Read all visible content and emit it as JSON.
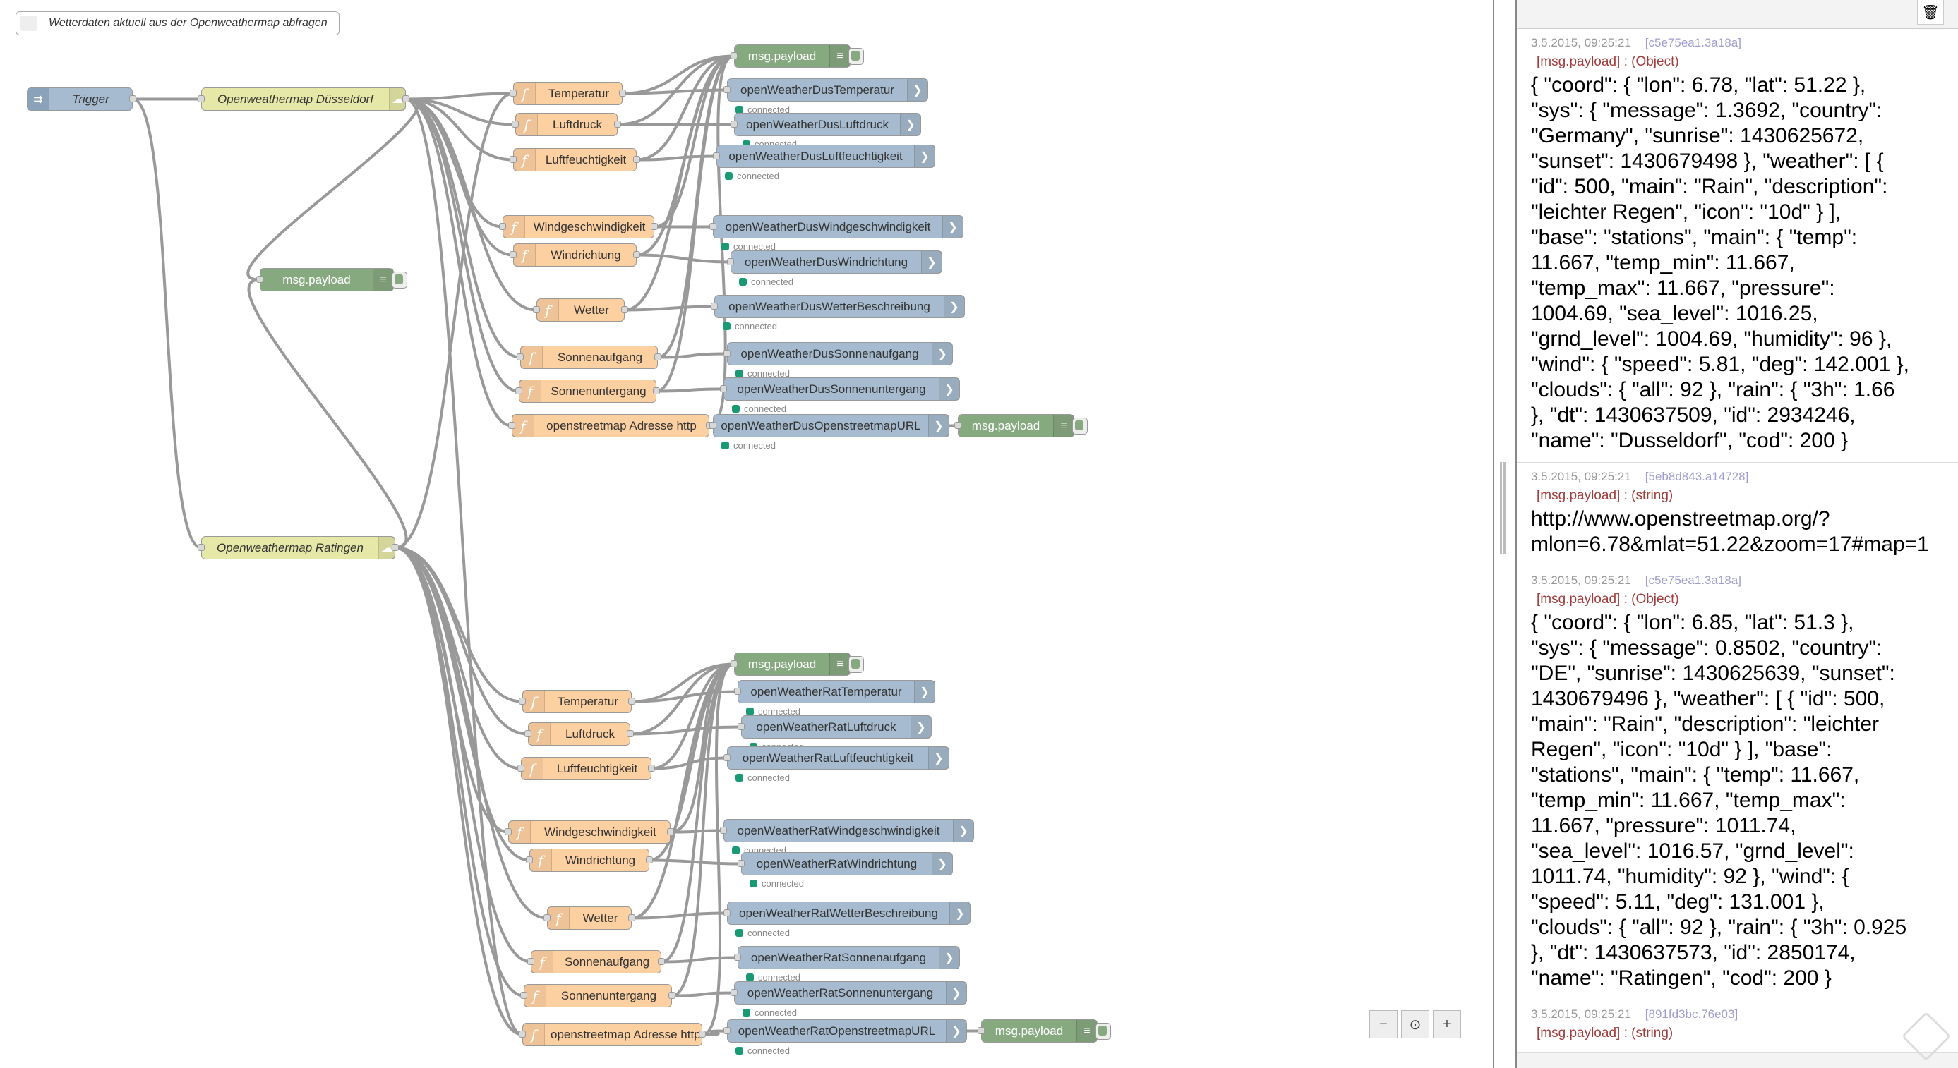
{
  "comment": "Wetterdaten aktuell aus der Openweathermap abfragen",
  "trigger": "Trigger",
  "weather_nodes": [
    "Openweathermap Düsseldorf",
    "Openweathermap Ratingen"
  ],
  "debug_label": "msg.payload",
  "status_text": "connected",
  "function_nodes": [
    "Temperatur",
    "Luftdruck",
    "Luftfeuchtigkeit",
    "Windgeschwindigkeit",
    "Windrichtung",
    "Wetter",
    "Sonnenaufgang",
    "Sonnenuntergang",
    "openstreetmap Adresse http"
  ],
  "mqtt_dus": [
    "openWeatherDusTemperatur",
    "openWeatherDusLuftdruck",
    "openWeatherDusLuftfeuchtigkeit",
    "openWeatherDusWindgeschwindigkeit",
    "openWeatherDusWindrichtung",
    "openWeatherDusWetterBeschreibung",
    "openWeatherDusSonnenaufgang",
    "openWeatherDusSonnenuntergang",
    "openWeatherDusOpenstreetmapURL"
  ],
  "mqtt_rat": [
    "openWeatherRatTemperatur",
    "openWeatherRatLuftdruck",
    "openWeatherRatLuftfeuchtigkeit",
    "openWeatherRatWindgeschwindigkeit",
    "openWeatherRatWindrichtung",
    "openWeatherRatWetterBeschreibung",
    "openWeatherRatSonnenaufgang",
    "openWeatherRatSonnenuntergang",
    "openWeatherRatOpenstreetmapURL"
  ],
  "icons": {
    "function": "function-icon",
    "mqtt_out": "mqtt-output-icon",
    "debug": "debug-list-icon",
    "inject": "inject-arrow-icon",
    "trash": "trash-icon",
    "zoom_out": "zoom-out-icon",
    "zoom_reset": "zoom-reset-icon",
    "zoom_in": "zoom-in-icon"
  },
  "colors": {
    "function": "#fdd0a2",
    "weather": "#e6e8a8",
    "mqtt": "#a6bbcf",
    "debug": "#87a980",
    "status_dot": "#1a9a74",
    "topic": "#a23d3d"
  },
  "debug_messages": [
    {
      "time": "3.5.2015, 09:25:21",
      "node_id": "[c5e75ea1.3a18a]",
      "topic": "[msg.payload] : (Object)",
      "body": "{ \"coord\": { \"lon\": 6.78, \"lat\": 51.22 },\n\"sys\": { \"message\": 1.3692, \"country\":\n\"Germany\", \"sunrise\": 1430625672,\n\"sunset\": 1430679498 }, \"weather\": [ {\n\"id\": 500, \"main\": \"Rain\", \"description\":\n\"leichter Regen\", \"icon\": \"10d\" } ],\n\"base\": \"stations\", \"main\": { \"temp\":\n11.667, \"temp_min\": 11.667,\n\"temp_max\": 11.667, \"pressure\":\n1004.69, \"sea_level\": 1016.25,\n\"grnd_level\": 1004.69, \"humidity\": 96 },\n\"wind\": { \"speed\": 5.81, \"deg\": 142.001 },\n\"clouds\": { \"all\": 92 }, \"rain\": { \"3h\": 1.66\n}, \"dt\": 1430637509, \"id\": 2934246,\n\"name\": \"Dusseldorf\", \"cod\": 200 }"
    },
    {
      "time": "3.5.2015, 09:25:21",
      "node_id": "[5eb8d843.a14728]",
      "topic": "[msg.payload] : (string)",
      "body": "http://www.openstreetmap.org/?\nmlon=6.78&mlat=51.22&zoom=17#map=1"
    },
    {
      "time": "3.5.2015, 09:25:21",
      "node_id": "[c5e75ea1.3a18a]",
      "topic": "[msg.payload] : (Object)",
      "body": "{ \"coord\": { \"lon\": 6.85, \"lat\": 51.3 },\n\"sys\": { \"message\": 0.8502, \"country\":\n\"DE\", \"sunrise\": 1430625639, \"sunset\":\n1430679496 }, \"weather\": [ { \"id\": 500,\n\"main\": \"Rain\", \"description\": \"leichter\nRegen\", \"icon\": \"10d\" } ], \"base\":\n\"stations\", \"main\": { \"temp\": 11.667,\n\"temp_min\": 11.667, \"temp_max\":\n11.667, \"pressure\": 1011.74,\n\"sea_level\": 1016.57, \"grnd_level\":\n1011.74, \"humidity\": 92 }, \"wind\": {\n\"speed\": 5.11, \"deg\": 131.001 },\n\"clouds\": { \"all\": 92 }, \"rain\": { \"3h\": 0.925\n}, \"dt\": 1430637573, \"id\": 2850174,\n\"name\": \"Ratingen\", \"cod\": 200 }"
    },
    {
      "time": "3.5.2015, 09:25:21",
      "node_id": "[891fd3bc.76e03]",
      "topic": "[msg.payload] : (string)",
      "body": ""
    }
  ]
}
